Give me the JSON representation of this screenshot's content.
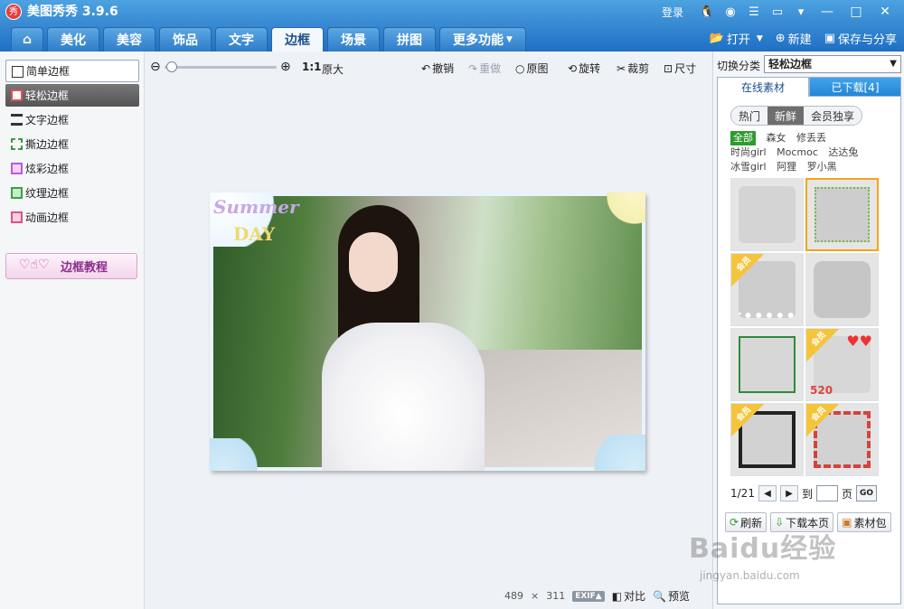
{
  "app": {
    "logo_text": "秀",
    "title": "美图秀秀 3.9.6"
  },
  "titlebar": {
    "login": "登录",
    "icons": [
      "qq-icon",
      "weibo-icon",
      "menu-icon",
      "feedback-icon",
      "dropdown-icon",
      "minimize-icon",
      "maximize-icon",
      "close-icon"
    ],
    "minimize": "—",
    "maximize": "□",
    "close": "✕"
  },
  "tabs": [
    {
      "label": ""
    },
    {
      "label": "美化"
    },
    {
      "label": "美容"
    },
    {
      "label": "饰品"
    },
    {
      "label": "文字"
    },
    {
      "label": "边框"
    },
    {
      "label": "场景"
    },
    {
      "label": "拼图"
    },
    {
      "label": "更多功能"
    }
  ],
  "active_tab": "边框",
  "header_actions": {
    "open": "打开",
    "new": "新建",
    "save_share": "保存与分享"
  },
  "left": {
    "items": [
      {
        "label": "简单边框"
      },
      {
        "label": "轻松边框"
      },
      {
        "label": "文字边框"
      },
      {
        "label": "撕边边框"
      },
      {
        "label": "炫彩边框"
      },
      {
        "label": "纹理边框"
      },
      {
        "label": "动画边框"
      }
    ],
    "selected": "轻松边框",
    "tutorial": "边框教程"
  },
  "toolbar": {
    "ratio": "1:1",
    "original_size": "原大",
    "undo": "撤销",
    "redo": "重做",
    "original": "原图",
    "rotate": "旋转",
    "crop": "裁剪",
    "size": "尺寸"
  },
  "photo": {
    "overlay_text_1": "Summer",
    "overlay_text_2": "DAY"
  },
  "status": {
    "width": "489",
    "times": "×",
    "height": "311",
    "exif": "EXIF▲",
    "compare": "对比",
    "preview": "预览"
  },
  "right": {
    "switch_label": "切换分类",
    "category": "轻松边框",
    "tab_online": "在线素材",
    "tab_downloaded": "已下载[4]",
    "seg": [
      "热门",
      "新鲜",
      "会员独享"
    ],
    "seg_active": "新鲜",
    "tags": [
      "全部",
      "森女",
      "修丢丢",
      "时尚girl",
      "Mocmoc",
      "达达兔",
      "冰雪girl",
      "阿狸",
      "罗小黑"
    ],
    "tag_active": "全部",
    "thumb_vip": "会员",
    "thumb_520": "520",
    "page": "1/21",
    "to": "到",
    "page_unit": "页",
    "go": "GO",
    "refresh": "刷新",
    "download_page": "下载本页",
    "pack": "素材包"
  },
  "watermark": {
    "main": "Baidu经验",
    "sub": "jingyan.baidu.com"
  },
  "colors": {
    "titlebar": "#2f80d0",
    "accent_green": "#2e9b2e",
    "vip_yellow": "#f4c43b",
    "selected_border": "#f2a51a"
  }
}
